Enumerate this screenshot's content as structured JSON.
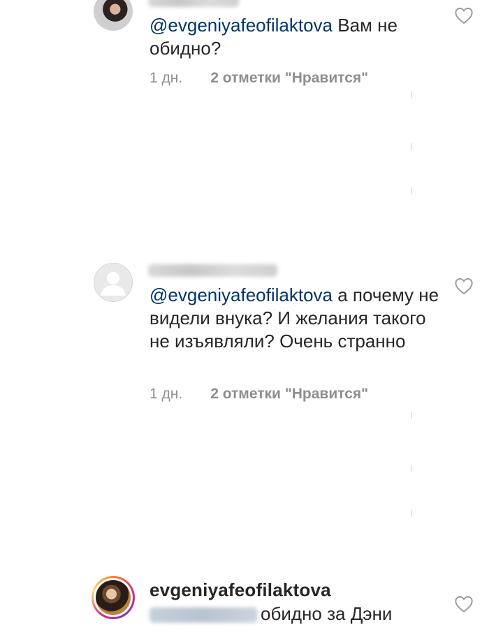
{
  "comments": [
    {
      "mention": "@evgeniyafeofilaktova",
      "text": " Вам не обидно?",
      "time": "1 дн.",
      "likes": "2 отметки \"Нравится\""
    },
    {
      "mention": "@evgeniyafeofilaktova",
      "text": " а почему не видели внука? И желания такого не изъявляли? Очень странно",
      "time": "1 дн.",
      "likes": "2 отметки \"Нравится\""
    },
    {
      "username": "evgeniyafeofilaktova",
      "text": "обидно за Дэни"
    }
  ],
  "icons": {
    "like": "heart-outline-icon"
  },
  "colors": {
    "mention": "#003569",
    "meta": "#8e8e8e",
    "text": "#262626",
    "heart": "#9a9a9a"
  }
}
